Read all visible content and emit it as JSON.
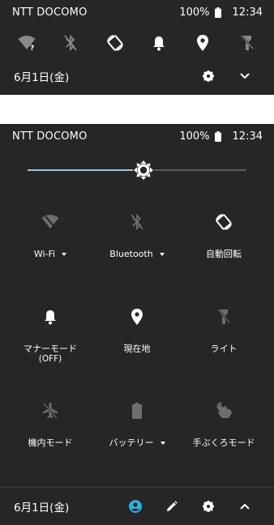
{
  "status": {
    "carrier": "NTT DOCOMO",
    "battery": "100%",
    "time": "12:34"
  },
  "collapsed": {
    "quick_icons": [
      "wifi-question-icon",
      "bluetooth-off-icon",
      "auto-rotate-icon",
      "bell-icon",
      "location-icon",
      "flashlight-off-icon"
    ],
    "date": "6月1日(金)"
  },
  "expanded": {
    "brightness_level": 0.53,
    "tiles": [
      {
        "label": "Wi-Fi",
        "sub": "",
        "icon": "wifi-off-icon",
        "active": false,
        "dropdown": true
      },
      {
        "label": "Bluetooth",
        "sub": "",
        "icon": "bluetooth-off-icon",
        "active": false,
        "dropdown": true
      },
      {
        "label": "自動回転",
        "sub": "",
        "icon": "auto-rotate-icon",
        "active": true,
        "dropdown": false
      },
      {
        "label": "マナーモード",
        "sub": "(OFF)",
        "icon": "bell-icon",
        "active": true,
        "dropdown": false
      },
      {
        "label": "現在地",
        "sub": "",
        "icon": "location-icon",
        "active": true,
        "dropdown": false
      },
      {
        "label": "ライト",
        "sub": "",
        "icon": "flashlight-off-icon",
        "active": false,
        "dropdown": false
      },
      {
        "label": "機内モード",
        "sub": "",
        "icon": "airplane-off-icon",
        "active": false,
        "dropdown": false
      },
      {
        "label": "バッテリー",
        "sub": "",
        "icon": "battery-saver-icon",
        "active": false,
        "dropdown": true
      },
      {
        "label": "手ぶくろモード",
        "sub": "",
        "icon": "glove-mode-icon",
        "active": false,
        "dropdown": false
      }
    ],
    "date": "6月1日(金)"
  },
  "colors": {
    "panel_bg": "#262626",
    "accent": "#2bb3d9",
    "inactive_icon": "#8a8a8a",
    "slider_filled": "#9ec5e8"
  }
}
